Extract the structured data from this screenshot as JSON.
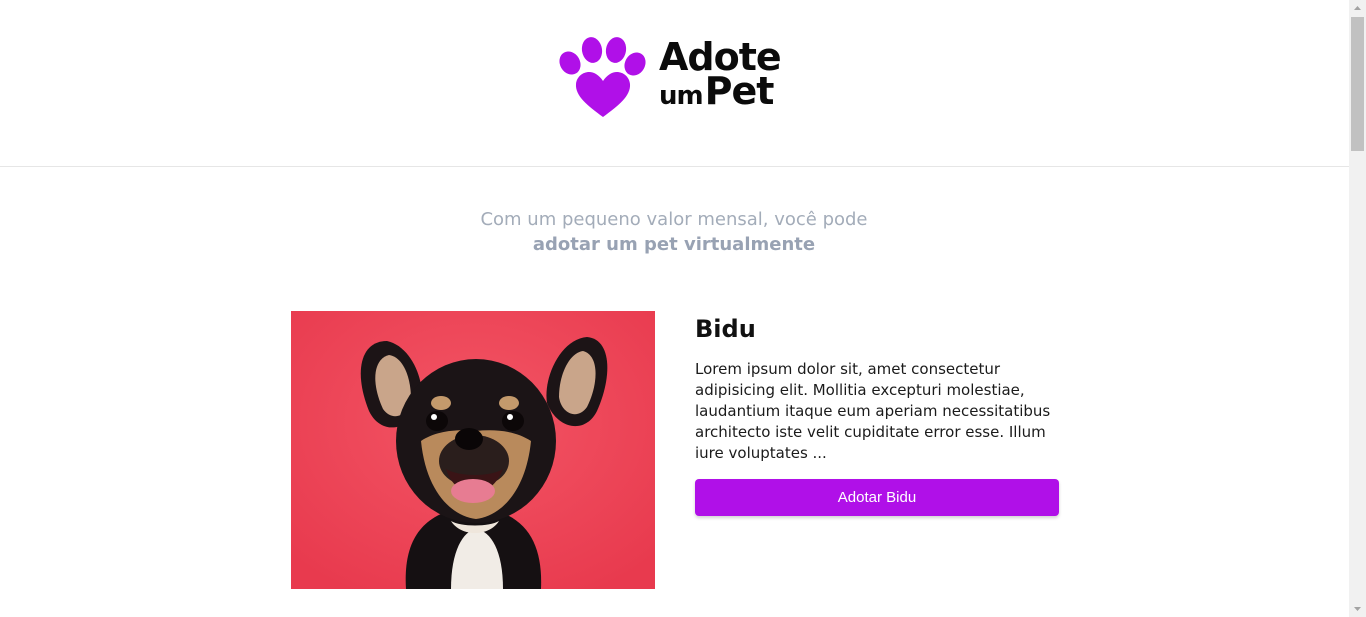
{
  "header": {
    "logo": {
      "line1": "Adote",
      "line2_small": "um",
      "line2_big": "Pet",
      "icon": "paw-heart-icon",
      "color": "#b010e8"
    }
  },
  "tagline": {
    "text": "Com um pequeno valor mensal, você pode ",
    "emphasis": "adotar um pet virtualmente"
  },
  "pets": [
    {
      "name": "Bidu",
      "description": "Lorem ipsum dolor sit, amet consectetur adipisicing elit. Mollitia excepturi molestiae, laudantium itaque eum aperiam necessitatibus architecto iste velit cupiditate error esse. Illum iure voluptates ...",
      "button_label": "Adotar Bidu",
      "photo_icon": "chihuahua-photo",
      "photo_bg": "#f0485a"
    }
  ],
  "colors": {
    "accent": "#b010e8",
    "muted_text": "#a3acb9"
  }
}
